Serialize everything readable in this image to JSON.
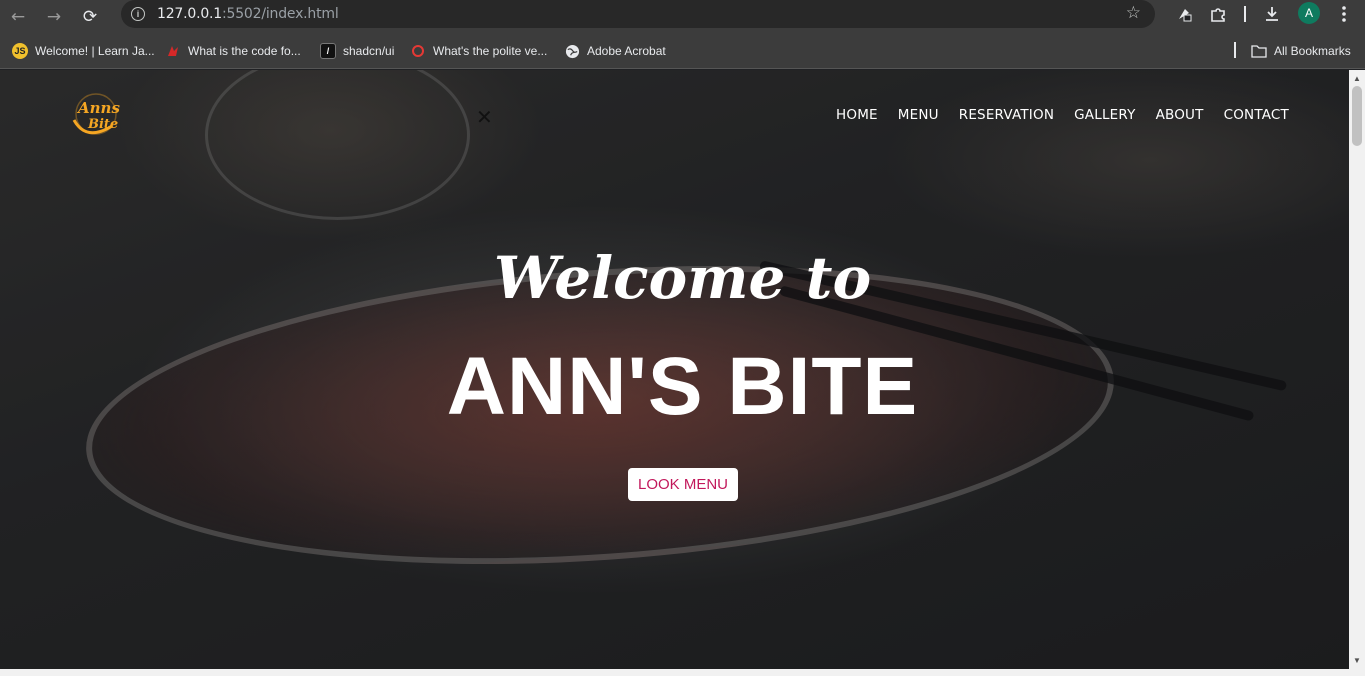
{
  "browser": {
    "url_host": "127.0.0.1",
    "url_rest": ":5502/index.html",
    "profile_initial": "A",
    "nav": {
      "back": "←",
      "forward": "→",
      "reload": "⟳"
    },
    "icons": {
      "info": "info-icon",
      "star": "star-icon",
      "extensions": "puzzle-icon",
      "download": "download-icon",
      "menu": "more-vert-icon"
    }
  },
  "bookmarks": {
    "items": [
      {
        "label": "Welcome! | Learn Ja...",
        "fav": "JS",
        "color": "#f0c02d"
      },
      {
        "label": "What is the code fo...",
        "fav": "",
        "color": "#d62828"
      },
      {
        "label": "shadcn/ui",
        "fav": "/",
        "color": "#111111"
      },
      {
        "label": "What's the polite ve...",
        "fav": "",
        "color": "#e53935"
      },
      {
        "label": "Adobe Acrobat",
        "fav": "",
        "color": "#dddddd"
      }
    ],
    "all_bookmarks": "All Bookmarks"
  },
  "site": {
    "close_symbol": "✕",
    "nav": [
      "HOME",
      "MENU",
      "RESERVATION",
      "GALLERY",
      "ABOUT",
      "CONTACT"
    ],
    "welcome": "Welcome to",
    "brand": "ANN'S BITE",
    "cta": "LOOK MENU",
    "logo_text_1": "Anns",
    "logo_text_2": "Bite",
    "colors": {
      "cta_text": "#c2185b",
      "logo_orange": "#f5a623"
    }
  }
}
